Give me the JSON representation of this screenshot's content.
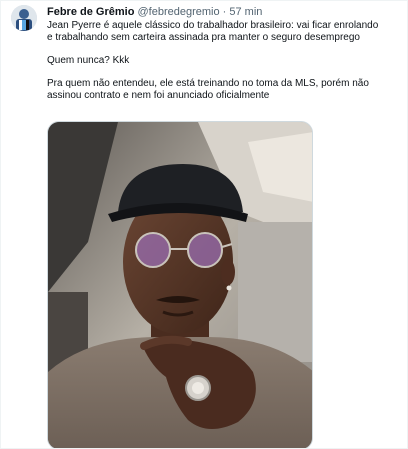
{
  "tweet": {
    "author_name": "Febre de Grêmio",
    "author_handle": "@febredegremio",
    "separator": "·",
    "time_ago": "57 min",
    "paragraphs": [
      [
        "Jean Pyerre é aquele clássico do trabalhador brasileiro: vai ficar enrolando",
        "e trabalhando sem carteira assinada pra manter o seguro desemprego"
      ],
      [
        "Quem nunca? Kkk"
      ],
      [
        "Pra quem não entendeu, ele está treinando no toma da MLS, porém não",
        "assinou contrato e nem foi anunciado oficialmente"
      ]
    ]
  },
  "colors": {
    "text": "#0f1419",
    "secondary_text": "#536471",
    "media_border": "#cfd9de"
  },
  "icons": {
    "avatar": "gremio-crest-avatar"
  },
  "media": {
    "description_name": "selfie-photo"
  }
}
